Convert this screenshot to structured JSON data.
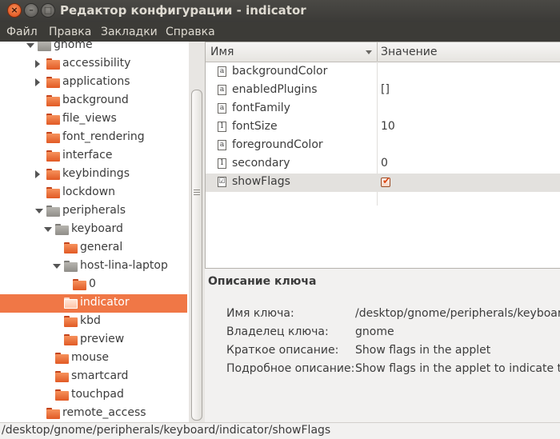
{
  "window": {
    "title": "Редактор конфигурации - indicator",
    "close": "×",
    "minimize": "–",
    "maximize": "□"
  },
  "menu": [
    "Файл",
    "Правка",
    "Закладки",
    "Справка"
  ],
  "tree": [
    {
      "label": "gnome",
      "indent": 0,
      "arrow": "down",
      "color": "gray",
      "partial": true
    },
    {
      "label": "accessibility",
      "indent": 1,
      "arrow": "right",
      "color": "orange"
    },
    {
      "label": "applications",
      "indent": 1,
      "arrow": "right",
      "color": "orange"
    },
    {
      "label": "background",
      "indent": 1,
      "arrow": "",
      "color": "orange"
    },
    {
      "label": "file_views",
      "indent": 1,
      "arrow": "",
      "color": "orange"
    },
    {
      "label": "font_rendering",
      "indent": 1,
      "arrow": "",
      "color": "orange"
    },
    {
      "label": "interface",
      "indent": 1,
      "arrow": "",
      "color": "orange"
    },
    {
      "label": "keybindings",
      "indent": 1,
      "arrow": "right",
      "color": "orange"
    },
    {
      "label": "lockdown",
      "indent": 1,
      "arrow": "",
      "color": "orange"
    },
    {
      "label": "peripherals",
      "indent": 1,
      "arrow": "down",
      "color": "gray"
    },
    {
      "label": "keyboard",
      "indent": 2,
      "arrow": "down",
      "color": "gray"
    },
    {
      "label": "general",
      "indent": 3,
      "arrow": "",
      "color": "orange"
    },
    {
      "label": "host-lina-laptop",
      "indent": 3,
      "arrow": "down",
      "color": "gray"
    },
    {
      "label": "0",
      "indent": 4,
      "arrow": "",
      "color": "orange"
    },
    {
      "label": "indicator",
      "indent": 3,
      "arrow": "",
      "color": "orange",
      "selected": true
    },
    {
      "label": "kbd",
      "indent": 3,
      "arrow": "",
      "color": "orange"
    },
    {
      "label": "preview",
      "indent": 3,
      "arrow": "",
      "color": "orange"
    },
    {
      "label": "mouse",
      "indent": 2,
      "arrow": "",
      "color": "orange"
    },
    {
      "label": "smartcard",
      "indent": 2,
      "arrow": "",
      "color": "orange"
    },
    {
      "label": "touchpad",
      "indent": 2,
      "arrow": "",
      "color": "orange"
    },
    {
      "label": "remote_access",
      "indent": 1,
      "arrow": "",
      "color": "orange"
    }
  ],
  "table": {
    "col_name": "Имя",
    "col_value": "Значение",
    "rows": [
      {
        "icon": "a",
        "name": "backgroundColor",
        "value": ""
      },
      {
        "icon": "a",
        "name": "enabledPlugins",
        "value": "[]"
      },
      {
        "icon": "a",
        "name": "fontFamily",
        "value": ""
      },
      {
        "icon": "1",
        "name": "fontSize",
        "value": "10"
      },
      {
        "icon": "a",
        "name": "foregroundColor",
        "value": ""
      },
      {
        "icon": "1",
        "name": "secondary",
        "value": "0"
      },
      {
        "icon": "☑",
        "name": "showFlags",
        "value": "",
        "checkbox": true,
        "checked": true,
        "selected": true
      }
    ]
  },
  "description": {
    "heading": "Описание ключа",
    "fields": [
      {
        "label": "Имя ключа:",
        "value": "/desktop/gnome/peripherals/keyboard/indicator/showFlags"
      },
      {
        "label": "Владелец ключа:",
        "value": "gnome"
      },
      {
        "label": "Краткое описание:",
        "value": "Show flags in the applet"
      },
      {
        "label": "Подробное описание:",
        "value": "Show flags in the applet to indicate the current layout"
      }
    ]
  },
  "status": "/desktop/gnome/peripherals/keyboard/indicator/showFlags",
  "colors": {
    "accent": "#f07746",
    "titlebar": "#3c3b37",
    "folder_orange": "#e15a25",
    "folder_gray": "#8f8d88"
  }
}
